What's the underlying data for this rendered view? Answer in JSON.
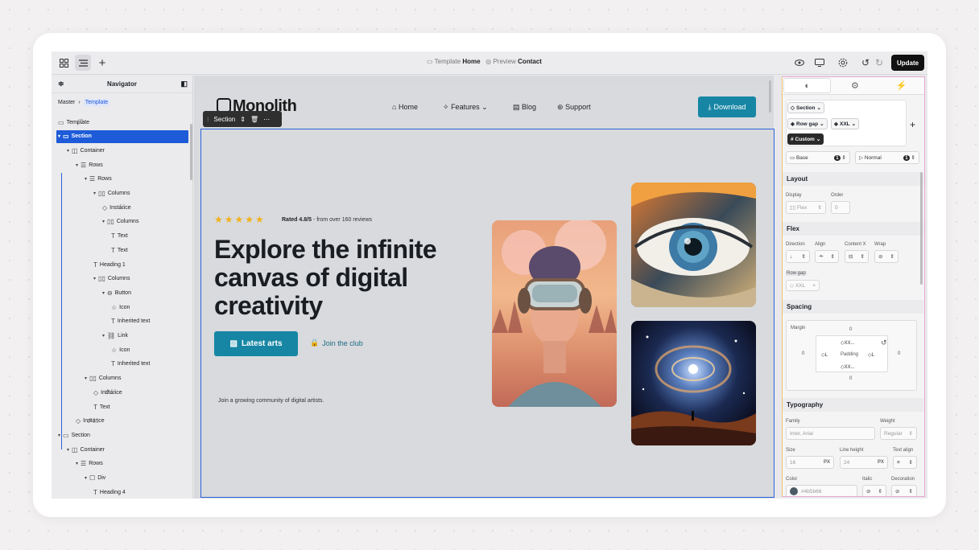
{
  "topbar": {
    "template_label": "Template",
    "template_name": "Home",
    "preview_label": "Preview",
    "preview_name": "Contact",
    "update_label": "Update"
  },
  "navigator": {
    "title": "Navigator",
    "breadcrumb": [
      "Master",
      "Template"
    ],
    "tree": [
      {
        "label": "Template",
        "indent": 0,
        "icon": "template-icon"
      },
      {
        "label": "Section",
        "indent": 0,
        "icon": "section-icon",
        "selected": true
      },
      {
        "label": "Container",
        "indent": 1,
        "icon": "container-icon"
      },
      {
        "label": "Rows",
        "indent": 2,
        "icon": "rows-icon"
      },
      {
        "label": "Rows",
        "indent": 3,
        "icon": "rows-icon"
      },
      {
        "label": "Columns",
        "indent": 4,
        "icon": "columns-icon"
      },
      {
        "label": "Instance",
        "indent": 5,
        "icon": "instance-icon"
      },
      {
        "label": "Columns",
        "indent": 5,
        "icon": "columns-icon"
      },
      {
        "label": "Text",
        "indent": 6,
        "icon": "text-icon"
      },
      {
        "label": "Text",
        "indent": 6,
        "icon": "text-icon"
      },
      {
        "label": "Heading 1",
        "indent": 4,
        "icon": "text-icon"
      },
      {
        "label": "Columns",
        "indent": 4,
        "icon": "columns-icon"
      },
      {
        "label": "Button",
        "indent": 5,
        "icon": "button-icon"
      },
      {
        "label": "Icon",
        "indent": 6,
        "icon": "star-icon"
      },
      {
        "label": "Inherited text",
        "indent": 6,
        "icon": "text-icon"
      },
      {
        "label": "Link",
        "indent": 5,
        "icon": "link-icon"
      },
      {
        "label": "Icon",
        "indent": 6,
        "icon": "star-icon"
      },
      {
        "label": "Inherited text",
        "indent": 6,
        "icon": "text-icon"
      },
      {
        "label": "Columns",
        "indent": 3,
        "icon": "columns-icon"
      },
      {
        "label": "Instance",
        "indent": 4,
        "icon": "instance-icon"
      },
      {
        "label": "Text",
        "indent": 4,
        "icon": "text-icon"
      },
      {
        "label": "Instance",
        "indent": 2,
        "icon": "instance-icon"
      },
      {
        "label": "Section",
        "indent": 0,
        "icon": "section-icon"
      },
      {
        "label": "Container",
        "indent": 1,
        "icon": "container-icon"
      },
      {
        "label": "Rows",
        "indent": 2,
        "icon": "rows-icon"
      },
      {
        "label": "Div",
        "indent": 3,
        "icon": "div-icon"
      },
      {
        "label": "Heading 4",
        "indent": 4,
        "icon": "text-icon"
      }
    ]
  },
  "site": {
    "float_bar_label": "Section",
    "logo": "Monolith",
    "nav": [
      "Home",
      "Features",
      "Blog",
      "Support"
    ],
    "download_label": "Download",
    "rating_text": "Rated 4.8/5",
    "rating_sub": " - from over 160 reviews",
    "hero_line1": "Explore the infinite",
    "hero_line2": "canvas of digital",
    "hero_line3": "creativity",
    "primary_button": "Latest arts",
    "secondary_link": "Join the club",
    "community_text": "Join a growing community of digital artists."
  },
  "props": {
    "selector_section": "Section",
    "chip_rowgap": "Row gap",
    "chip_xxl": "XXL",
    "chip_custom": "Custom",
    "state_base": "Base",
    "state_normal": "Normal",
    "state_count": "1",
    "layout_title": "Layout",
    "display_label": "Display",
    "display_value": "Flex",
    "order_label": "Order",
    "order_value": "0",
    "flex_title": "Flex",
    "direction_label": "Direction",
    "align_label": "Align",
    "content_x_label": "Content X",
    "wrap_label": "Wrap",
    "row_gap_label": "Row gap",
    "row_gap_value": "XXL",
    "spacing_title": "Spacing",
    "margin_label": "Margin",
    "margin_top": "0",
    "margin_left": "0",
    "margin_right": "0",
    "margin_bottom": "0",
    "padding_label": "Padding",
    "padding_top": "XX...",
    "padding_bottom": "XX...",
    "padding_left": "L",
    "padding_right": "L",
    "typography_title": "Typography",
    "family_label": "Family",
    "family_value": "Inter, Arial",
    "weight_label": "Weight",
    "weight_value": "Regular",
    "size_label": "Size",
    "size_value": "16",
    "line_height_label": "Line height",
    "line_height_value": "24",
    "text_align_label": "Text align",
    "unit_px": "PX",
    "color_label": "Color",
    "color_value": "#4b5b66",
    "italic_label": "Italic",
    "decoration_label": "Decoration"
  },
  "colors": {
    "accent": "#1786a4",
    "selection": "#1d5bd8",
    "text_color": "#4b5b66"
  }
}
